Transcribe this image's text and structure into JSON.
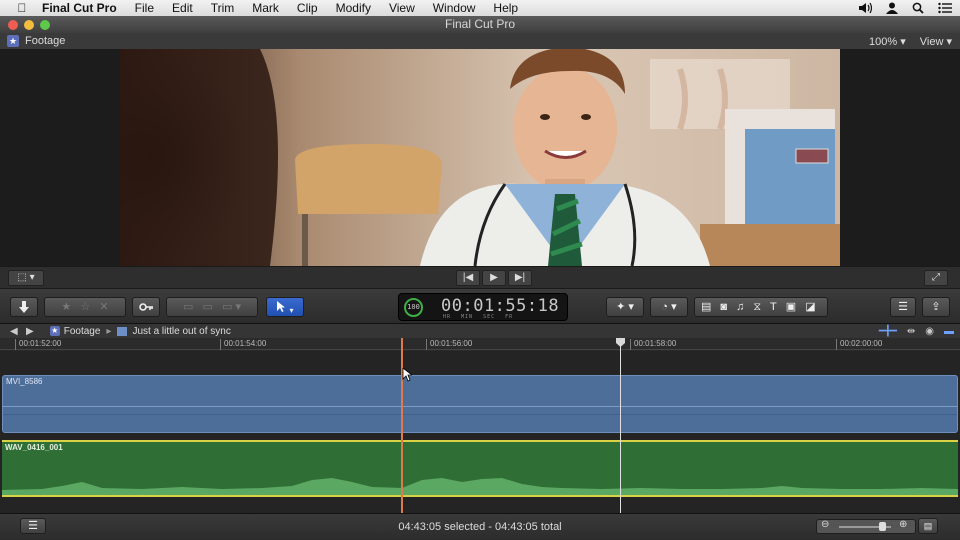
{
  "menubar": {
    "items": [
      "Final Cut Pro",
      "File",
      "Edit",
      "Trim",
      "Mark",
      "Clip",
      "Modify",
      "View",
      "Window",
      "Help"
    ]
  },
  "window": {
    "title": "Final Cut Pro"
  },
  "viewer": {
    "library_label": "Footage",
    "zoom": "100%",
    "view_menu": "View"
  },
  "timecode": {
    "value": "00:01:55:18",
    "units": "HR MIN SEC FR",
    "percent": "100"
  },
  "timeline": {
    "breadcrumb_event": "Footage",
    "breadcrumb_project": "Just a little out of sync",
    "ruler": [
      "00:01:52:00",
      "00:01:54:00",
      "00:01:56:00",
      "00:01:58:00",
      "00:02:00:00"
    ],
    "video_clip": "MVI_8586",
    "audio_clip": "WAV_0416_001"
  },
  "status": {
    "text": "04:43:05 selected - 04:43:05 total"
  },
  "colors": {
    "accent": "#2150b0",
    "video_clip": "#4e6e9a",
    "audio_clip": "#2f6e35",
    "playhead": "#e07a4a"
  }
}
